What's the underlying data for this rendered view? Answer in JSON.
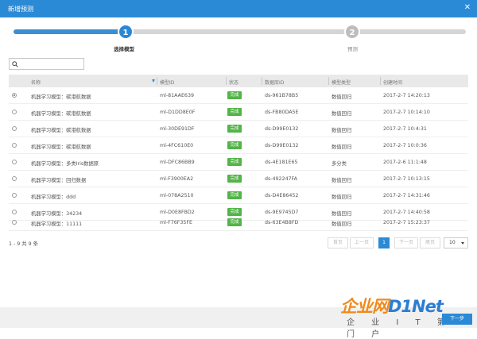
{
  "dialog": {
    "title": "新增预测",
    "close_icon": "close-icon"
  },
  "steps": [
    {
      "number": "1",
      "label": "选择模型",
      "state": "active"
    },
    {
      "number": "2",
      "label": "预测",
      "state": "inactive"
    }
  ],
  "search": {
    "placeholder": "",
    "value": "",
    "icon": "search-icon"
  },
  "table": {
    "columns": [
      "名称",
      "模型ID",
      "状态",
      "数据库ID",
      "模型类型",
      "创建时间"
    ],
    "rows": [
      {
        "name": "机器学习模型：碳港航数据",
        "model_id": "ml-81AAE639",
        "status": "完成",
        "db_id": "ds-961B78B5",
        "type": "数值回归",
        "created": "2017-2-7 14:20:13",
        "selected": true
      },
      {
        "name": "机器学习模型：碳港航数据",
        "model_id": "ml-D1DD8E0F",
        "status": "完成",
        "db_id": "ds-FB80DA5E",
        "type": "数值回归",
        "created": "2017-2-7 10:14:10",
        "selected": false
      },
      {
        "name": "机器学习模型：碳港航数据",
        "model_id": "ml-30DE91DF",
        "status": "完成",
        "db_id": "ds-D99E0132",
        "type": "数值回归",
        "created": "2017-2-7 10:4:31",
        "selected": false
      },
      {
        "name": "机器学习模型：碳港航数据",
        "model_id": "ml-4FC610E0",
        "status": "完成",
        "db_id": "ds-D99E0132",
        "type": "数值回归",
        "created": "2017-2-7 10:0:36",
        "selected": false
      },
      {
        "name": "机器学习模型：多类Iris数据原",
        "model_id": "ml-DFC86BB9",
        "status": "完成",
        "db_id": "ds-4E181E65",
        "type": "多分类",
        "created": "2017-2-6 11:1:48",
        "selected": false
      },
      {
        "name": "机器学习模型：回归数据",
        "model_id": "ml-F3900EA2",
        "status": "完成",
        "db_id": "ds-492247FA",
        "type": "数值回归",
        "created": "2017-2-7 10:13:15",
        "selected": false
      },
      {
        "name": "机器学习模型：ddd",
        "model_id": "ml-078A2510",
        "status": "完成",
        "db_id": "ds-D4E86452",
        "type": "数值回归",
        "created": "2017-2-7 14:31:46",
        "selected": false
      },
      {
        "name": "机器学习模型：34234",
        "model_id": "ml-D0E8FBD2",
        "status": "完成",
        "db_id": "ds-9E9745D7",
        "type": "数值回归",
        "created": "2017-2-7 14:40:58",
        "selected": false
      },
      {
        "name": "机器学习模型：11111",
        "model_id": "ml-F76F35FE",
        "status": "完成",
        "db_id": "ds-63E4B8FD",
        "type": "数值回归",
        "created": "2017-2-7 15:23:37",
        "selected": false
      }
    ]
  },
  "pagination": {
    "summary": "1 - 9 共 9 条",
    "first": "首页",
    "prev": "上一页",
    "current": "1",
    "next": "下一页",
    "last": "尾页",
    "page_size": "10"
  },
  "footer": {
    "next_button": "下一步"
  },
  "watermark": {
    "main": "企业网",
    "net": "D1Net",
    "sub": "企 业 I T 第 一 门 户"
  },
  "colors": {
    "accent": "#2b8ad6",
    "status_done": "#52b447",
    "watermark_orange": "#f08a1a"
  }
}
